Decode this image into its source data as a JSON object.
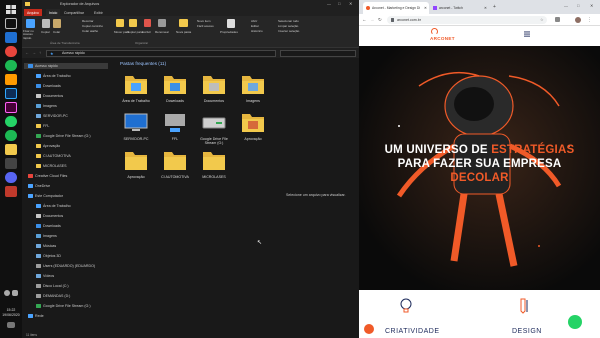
{
  "taskbar": {
    "clock_time": "15:22",
    "clock_date": "19/06/2020"
  },
  "explorer": {
    "title": "Explorador de Arquivos",
    "tabs": [
      "Arquivo",
      "Início",
      "Compartilhar",
      "Exibir"
    ],
    "ribbon": {
      "pin_label": "Fixar no Acesso rápido",
      "copy_label": "Copiar",
      "paste_label": "Colar",
      "cut_label": "Recortar",
      "copy_path_label": "Copiar caminho",
      "paste_shortcut_label": "Colar atalho",
      "group_clipboard": "Área de Transferência",
      "move_to_label": "Mover para",
      "copy_to_label": "Copiar para",
      "delete_label": "Excluir",
      "rename_label": "Renomear",
      "group_organize": "Organizar",
      "new_folder_label": "Nova pasta",
      "new_item_label": "Novo item",
      "easy_access_label": "Fácil acesso",
      "properties_label": "Propriedades",
      "open_label": "Abrir",
      "edit_label": "Editar",
      "history_label": "Histórico",
      "select_all_label": "Selecionar tudo",
      "select_none_label": "Limpar seleção",
      "invert_selection_label": "Inverter seleção"
    },
    "address": "Acesso rápido",
    "nav_items": [
      {
        "label": "Acesso rápido",
        "color": "#3b8fe8",
        "indent": 0,
        "selected": true
      },
      {
        "label": "Área de Trabalho",
        "color": "#4aa3ff",
        "indent": 1
      },
      {
        "label": "Downloads",
        "color": "#3b8fe8",
        "indent": 1
      },
      {
        "label": "Documentos",
        "color": "#c8c8c8",
        "indent": 1
      },
      {
        "label": "Imagens",
        "color": "#5aa0d8",
        "indent": 1
      },
      {
        "label": "SERVIDOR-PC",
        "color": "#6fa8dc",
        "indent": 1
      },
      {
        "label": "FFL",
        "color": "#f2c94c",
        "indent": 1
      },
      {
        "label": "Google Drive File Stream (G:)",
        "color": "#34a853",
        "indent": 1
      },
      {
        "label": "Aprovação",
        "color": "#f2c94c",
        "indent": 1
      },
      {
        "label": "CI AUTOMOTIVA",
        "color": "#f2c94c",
        "indent": 1
      },
      {
        "label": "MICROLASES",
        "color": "#f2c94c",
        "indent": 1
      },
      {
        "label": "Creative Cloud Files",
        "color": "#e8453c",
        "indent": 0
      },
      {
        "label": "OneDrive",
        "color": "#4aa3ff",
        "indent": 0
      },
      {
        "label": "Este Computador",
        "color": "#4aa3ff",
        "indent": 0
      },
      {
        "label": "Área de Trabalho",
        "color": "#4aa3ff",
        "indent": 1
      },
      {
        "label": "Documentos",
        "color": "#c8c8c8",
        "indent": 1
      },
      {
        "label": "Downloads",
        "color": "#3b8fe8",
        "indent": 1
      },
      {
        "label": "Imagens",
        "color": "#5aa0d8",
        "indent": 1
      },
      {
        "label": "Músicas",
        "color": "#6fa8dc",
        "indent": 1
      },
      {
        "label": "Objetos 3D",
        "color": "#6fa8dc",
        "indent": 1
      },
      {
        "label": "Users (EDUARDO) (EDUARDO)",
        "color": "#9e9e9e",
        "indent": 1
      },
      {
        "label": "Vídeos",
        "color": "#6fa8dc",
        "indent": 1
      },
      {
        "label": "Disco Local (C:)",
        "color": "#9e9e9e",
        "indent": 1
      },
      {
        "label": "DEMANDAS (D:)",
        "color": "#9e9e9e",
        "indent": 1
      },
      {
        "label": "Google Drive File Stream (G:)",
        "color": "#34a853",
        "indent": 1
      },
      {
        "label": "Rede",
        "color": "#4aa3ff",
        "indent": 0
      }
    ],
    "section_title": "Pastas frequentes (11)",
    "folders": [
      {
        "name": "Área de Trabalho",
        "kind": "desktop"
      },
      {
        "name": "Downloads",
        "kind": "downloads"
      },
      {
        "name": "Documentos",
        "kind": "documents"
      },
      {
        "name": "Imagens",
        "kind": "images"
      },
      {
        "name": "SERVIDOR-PC",
        "kind": "computer"
      },
      {
        "name": "FFL",
        "kind": "network"
      },
      {
        "name": "Google Drive File Stream (G:)",
        "kind": "drive"
      },
      {
        "name": "Aprovação",
        "kind": "photo"
      },
      {
        "name": "Aprovação",
        "kind": "folder"
      },
      {
        "name": "CI AUTOMOTIVA",
        "kind": "folder"
      },
      {
        "name": "MICROLASES",
        "kind": "folder"
      }
    ],
    "preview_hint": "Selecione um arquivo para visualizar.",
    "status": "11 itens"
  },
  "browser": {
    "tabs": [
      {
        "label": "Arconet - Marketing e Design Di",
        "active": true
      },
      {
        "label": "arconet - Twitch",
        "active": false
      }
    ],
    "url": "arconet.com.br",
    "brand": "ARCONET",
    "hero_line1_a": "UM UNIVERSO DE ",
    "hero_line1_b": "ESTRATÉGIAS",
    "hero_line2": "PARA FAZER SUA EMPRESA",
    "hero_line3": "DECOLAR",
    "features": [
      "CRIATIVIDADE",
      "DESIGN"
    ],
    "colors": {
      "accent": "#f05a28",
      "navy": "#1d2a5b"
    }
  }
}
